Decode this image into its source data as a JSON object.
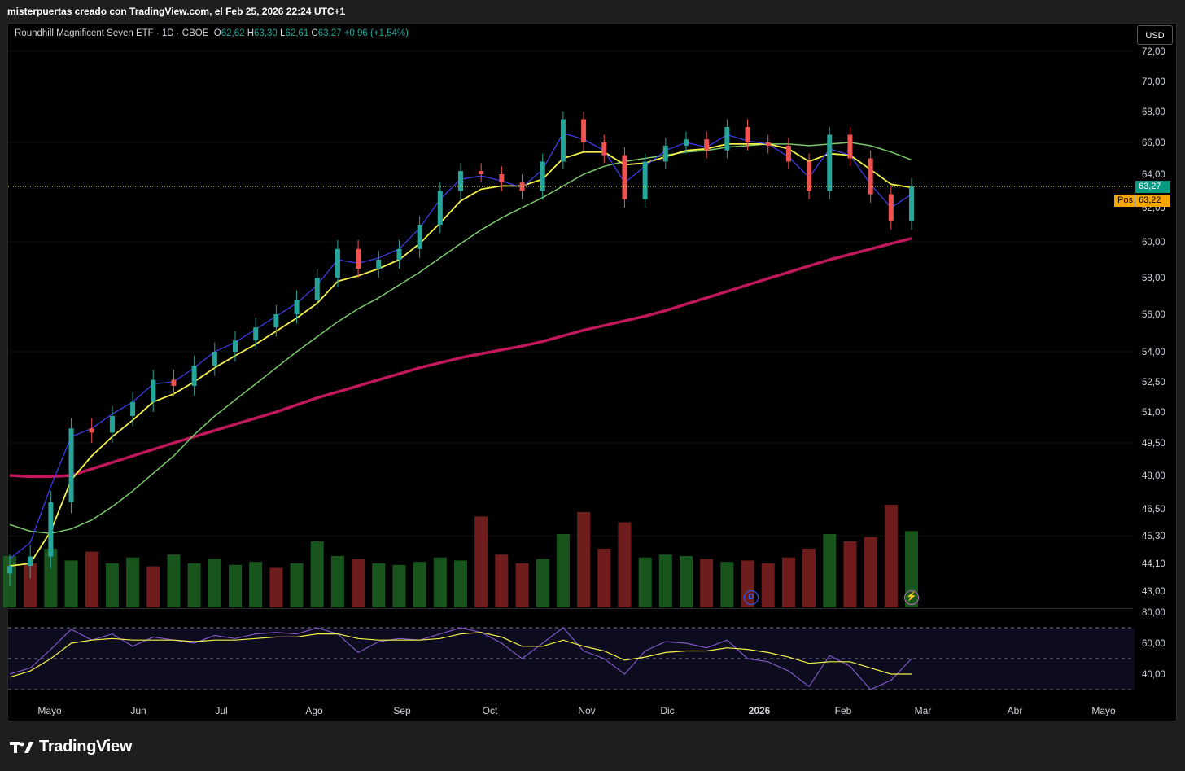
{
  "header": {
    "caption": "misterpuertas creado con TradingView.com, el Feb 25, 2026 22:24 UTC+1"
  },
  "legend": {
    "symbol": "Roundhill Magnificent Seven ETF · 1D · CBOE",
    "open_label": "O",
    "open": "62,62",
    "high_label": "H",
    "high": "63,30",
    "low_label": "L",
    "low": "62,61",
    "close_label": "C",
    "close": "63,27",
    "change": "+0,96 (+1,54%)"
  },
  "currency_button": "USD",
  "last_price_tag": "63,27",
  "position_tag": {
    "label": "Pos",
    "value": "63,22"
  },
  "events": {
    "dividend_marker": "D"
  },
  "footer": {
    "logo_text": "TradingView"
  },
  "colors": {
    "up": "#26a69a",
    "down": "#ef5350",
    "volume_up": "#1b5e20",
    "volume_down": "#7b1f1f",
    "ema_fast": "#3f3ff5",
    "ema_mid": "#f5f24a",
    "sma_50": "#7cc96b",
    "sma_200": "#c2185b",
    "rsi": "#7e57c2",
    "rsi_ma": "#f5f24a",
    "last_price_line": "#f5f24a"
  },
  "chart_data": {
    "type": "candlestick",
    "y_axis_ticks": [
      "72,00",
      "70,00",
      "68,00",
      "66,00",
      "64,00",
      "62,00",
      "60,00",
      "58,00",
      "56,00",
      "54,00",
      "52,50",
      "51,00",
      "49,50",
      "48,00",
      "46,50",
      "45,30",
      "44,10",
      "43,00"
    ],
    "y_axis_tick_values": [
      72,
      70,
      68,
      66,
      64,
      62,
      60,
      58,
      56,
      54,
      52.5,
      51,
      49.5,
      48,
      46.5,
      45.3,
      44.1,
      43
    ],
    "x_axis_labels": [
      "Mayo",
      "Jun",
      "Jul",
      "Ago",
      "Sep",
      "Oct",
      "Nov",
      "Dic",
      "2026",
      "Feb",
      "Mar",
      "Abr",
      "Mayo"
    ],
    "price_key_points": [
      {
        "date": "2025-04-21",
        "close": 44.0
      },
      {
        "date": "2025-04-28",
        "close": 44.4
      },
      {
        "date": "2025-05-05",
        "close": 46.8
      },
      {
        "date": "2025-05-12",
        "close": 50.2
      },
      {
        "date": "2025-05-19",
        "close": 50.0
      },
      {
        "date": "2025-05-26",
        "close": 50.8
      },
      {
        "date": "2025-06-02",
        "close": 51.5
      },
      {
        "date": "2025-06-09",
        "close": 52.6
      },
      {
        "date": "2025-06-16",
        "close": 52.3
      },
      {
        "date": "2025-06-23",
        "close": 53.3
      },
      {
        "date": "2025-06-30",
        "close": 54.0
      },
      {
        "date": "2025-07-07",
        "close": 54.6
      },
      {
        "date": "2025-07-14",
        "close": 55.3
      },
      {
        "date": "2025-07-21",
        "close": 56.0
      },
      {
        "date": "2025-07-28",
        "close": 56.8
      },
      {
        "date": "2025-08-04",
        "close": 58.0
      },
      {
        "date": "2025-08-11",
        "close": 59.6
      },
      {
        "date": "2025-08-18",
        "close": 58.5
      },
      {
        "date": "2025-08-25",
        "close": 59.0
      },
      {
        "date": "2025-09-01",
        "close": 59.6
      },
      {
        "date": "2025-09-08",
        "close": 61.0
      },
      {
        "date": "2025-09-15",
        "close": 63.0
      },
      {
        "date": "2025-09-22",
        "close": 64.2
      },
      {
        "date": "2025-09-29",
        "close": 64.0
      },
      {
        "date": "2025-10-06",
        "close": 63.5
      },
      {
        "date": "2025-10-13",
        "close": 63.0
      },
      {
        "date": "2025-10-20",
        "close": 64.8
      },
      {
        "date": "2025-10-27",
        "close": 67.5
      },
      {
        "date": "2025-11-03",
        "close": 66.0
      },
      {
        "date": "2025-11-10",
        "close": 65.2
      },
      {
        "date": "2025-11-17",
        "close": 62.5
      },
      {
        "date": "2025-11-24",
        "close": 64.8
      },
      {
        "date": "2025-12-01",
        "close": 65.8
      },
      {
        "date": "2025-12-08",
        "close": 66.2
      },
      {
        "date": "2025-12-15",
        "close": 65.5
      },
      {
        "date": "2025-12-22",
        "close": 67.0
      },
      {
        "date": "2025-12-29",
        "close": 66.0
      },
      {
        "date": "2026-01-05",
        "close": 65.8
      },
      {
        "date": "2026-01-12",
        "close": 64.8
      },
      {
        "date": "2026-01-19",
        "close": 63.0
      },
      {
        "date": "2026-01-26",
        "close": 66.5
      },
      {
        "date": "2026-02-02",
        "close": 65.0
      },
      {
        "date": "2026-02-09",
        "close": 62.8
      },
      {
        "date": "2026-02-16",
        "close": 61.2
      },
      {
        "date": "2026-02-25",
        "close": 63.27
      }
    ],
    "indicators": {
      "ema_fast": [
        44.3,
        45.0,
        47.5,
        49.8,
        50.2,
        50.9,
        51.5,
        52.4,
        52.5,
        53.2,
        54.0,
        54.5,
        55.2,
        55.9,
        56.6,
        57.6,
        59.0,
        58.8,
        59.1,
        59.6,
        60.8,
        62.5,
        63.7,
        63.9,
        63.6,
        63.2,
        64.3,
        66.6,
        66.2,
        65.5,
        63.5,
        64.5,
        65.5,
        66.0,
        65.7,
        66.5,
        66.1,
        65.9,
        65.1,
        63.8,
        65.6,
        65.2,
        63.4,
        62.0,
        62.8
      ],
      "ema_mid": [
        44.0,
        44.1,
        45.5,
        47.8,
        48.9,
        49.8,
        50.6,
        51.5,
        51.9,
        52.5,
        53.2,
        53.8,
        54.4,
        55.1,
        55.8,
        56.6,
        57.8,
        58.1,
        58.5,
        59.0,
        59.9,
        61.1,
        62.4,
        63.1,
        63.3,
        63.3,
        63.7,
        65.0,
        65.4,
        65.4,
        64.6,
        64.7,
        65.1,
        65.5,
        65.6,
        65.9,
        65.9,
        65.9,
        65.6,
        64.8,
        65.3,
        65.2,
        64.3,
        63.4,
        63.2
      ],
      "sma_50": [
        45.8,
        45.5,
        45.4,
        45.6,
        46.0,
        46.6,
        47.3,
        48.1,
        48.9,
        49.9,
        50.8,
        51.6,
        52.4,
        53.2,
        54.0,
        54.8,
        55.6,
        56.3,
        56.9,
        57.6,
        58.3,
        59.1,
        59.9,
        60.7,
        61.4,
        62.0,
        62.6,
        63.3,
        64.0,
        64.5,
        64.8,
        65.0,
        65.2,
        65.4,
        65.5,
        65.7,
        65.8,
        65.9,
        65.9,
        65.8,
        65.9,
        66.0,
        65.8,
        65.4,
        64.9
      ],
      "sma_200": [
        48.0,
        47.95,
        47.95,
        48.0,
        48.3,
        48.6,
        48.9,
        49.2,
        49.5,
        49.8,
        50.1,
        50.4,
        50.7,
        51.0,
        51.35,
        51.7,
        52.0,
        52.3,
        52.6,
        52.9,
        53.2,
        53.45,
        53.7,
        53.9,
        54.1,
        54.3,
        54.55,
        54.85,
        55.15,
        55.4,
        55.65,
        55.9,
        56.2,
        56.55,
        56.9,
        57.25,
        57.6,
        57.95,
        58.3,
        58.65,
        59.0,
        59.3,
        59.6,
        59.9,
        60.2
      ]
    },
    "volume": [
      0.35,
      0.3,
      0.4,
      0.32,
      0.38,
      0.3,
      0.34,
      0.28,
      0.36,
      0.3,
      0.33,
      0.29,
      0.31,
      0.27,
      0.3,
      0.45,
      0.35,
      0.33,
      0.3,
      0.29,
      0.31,
      0.34,
      0.32,
      0.62,
      0.36,
      0.3,
      0.33,
      0.5,
      0.65,
      0.4,
      0.58,
      0.34,
      0.36,
      0.35,
      0.33,
      0.31,
      0.32,
      0.3,
      0.34,
      0.4,
      0.5,
      0.45,
      0.48,
      0.7,
      0.52
    ],
    "volume_up": [
      true,
      false,
      true,
      true,
      false,
      true,
      true,
      false,
      true,
      true,
      true,
      true,
      true,
      false,
      true,
      true,
      true,
      false,
      true,
      true,
      true,
      true,
      true,
      false,
      false,
      false,
      true,
      true,
      false,
      false,
      false,
      true,
      true,
      true,
      false,
      true,
      false,
      false,
      false,
      false,
      true,
      false,
      false,
      false,
      true
    ],
    "rsi": {
      "upper": 70,
      "middle": 50,
      "lower": 30,
      "axis_ticks": [
        "80,00",
        "60,00",
        "40,00"
      ],
      "axis_tick_values": [
        80,
        60,
        40
      ],
      "values": [
        40,
        44,
        56,
        69,
        62,
        66,
        58,
        64,
        62,
        60,
        65,
        63,
        66,
        67,
        66,
        70,
        66,
        54,
        61,
        63,
        62,
        66,
        70,
        67,
        60,
        50,
        60,
        70,
        55,
        50,
        40,
        55,
        61,
        60,
        57,
        62,
        50,
        48,
        42,
        32,
        52,
        45,
        30,
        36,
        50
      ],
      "ma": [
        38,
        42,
        50,
        60,
        62,
        63,
        62,
        62,
        62,
        61,
        62,
        62,
        63,
        64,
        64,
        66,
        66,
        63,
        62,
        62,
        62,
        63,
        66,
        67,
        64,
        58,
        58,
        62,
        58,
        55,
        49,
        51,
        54,
        55,
        55,
        57,
        56,
        54,
        51,
        47,
        48,
        48,
        44,
        40,
        40
      ]
    }
  }
}
